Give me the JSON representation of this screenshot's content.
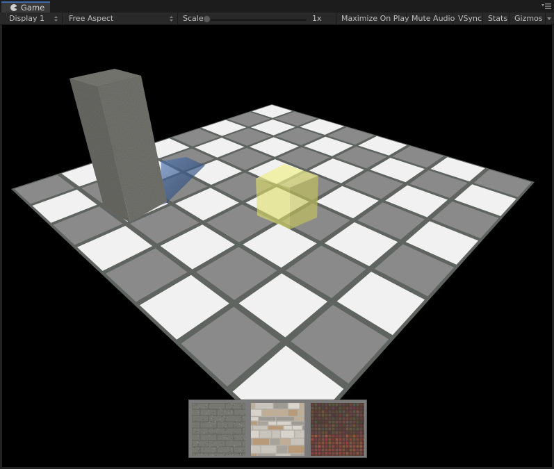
{
  "window": {
    "tab_label": "Game",
    "tab_icon": "unity-pacman-icon",
    "panel_menu_icon": "panel-menu-icon"
  },
  "toolbar": {
    "display": "Display 1",
    "aspect": "Free Aspect",
    "scale_label": "Scale",
    "scale_value": "1x",
    "scale_fraction": 0.0,
    "maximize_on_play": "Maximize On Play",
    "mute_audio": "Mute Audio",
    "vsync": "VSync",
    "stats": "Stats",
    "gizmos": "Gizmos"
  },
  "scene": {
    "board": {
      "rows": 8,
      "cols": 8,
      "top_corner": "light",
      "light_color": "#f1f1f1",
      "dark_color": "#8a8a8a",
      "grout_color": "#5f6460"
    },
    "objects": [
      {
        "name": "stone-pillar",
        "color": "#6f6f6a"
      },
      {
        "name": "transparent-yellow-cube",
        "color": "#e8e87a"
      },
      {
        "name": "pillar-shadow",
        "color": "#4a6a9a"
      }
    ]
  },
  "texture_picker": {
    "items": [
      {
        "name": "granite-bricks",
        "base": "#777772",
        "line": "#5d5d58"
      },
      {
        "name": "stone-wall",
        "base": "#b4b0a8",
        "line": "#3a3a36"
      },
      {
        "name": "metal-grid",
        "base": "#4a3a30",
        "line": "#1f1a16"
      }
    ]
  }
}
